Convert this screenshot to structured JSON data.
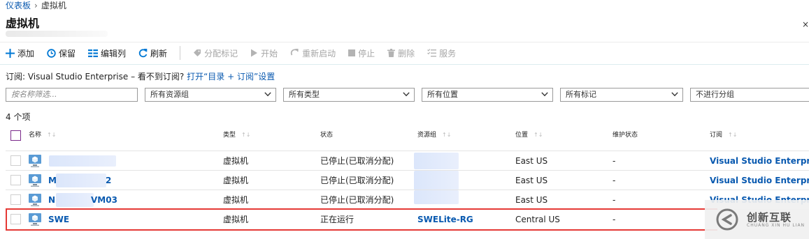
{
  "breadcrumb": {
    "home": "仪表板",
    "separator": "›",
    "current": "虚拟机"
  },
  "page": {
    "title": "虚拟机",
    "close_glyph": "×"
  },
  "toolbar": {
    "add": "添加",
    "save": "保留",
    "edit_columns": "编辑列",
    "refresh": "刷新",
    "assign_tags": "分配标记",
    "start": "开始",
    "restart": "重新启动",
    "stop": "停止",
    "delete": "删除",
    "services": "服务"
  },
  "subscription_line": {
    "prefix": "订阅: Visual Studio Enterprise – 看不到订阅? ",
    "link": "打开“目录 + 订阅”设置"
  },
  "filters": {
    "name_placeholder": "按名称筛选...",
    "resource_group": "所有资源组",
    "type": "所有类型",
    "location": "所有位置",
    "tags": "所有标记",
    "grouping": "不进行分组"
  },
  "count_label": "4 个项",
  "columns": {
    "name": "名称",
    "type": "类型",
    "status": "状态",
    "resource_group": "资源组",
    "location": "位置",
    "maintenance": "维护状态",
    "subscription": "订阅",
    "sort_glyph": "↑↓"
  },
  "rows": [
    {
      "name": "",
      "type": "虚拟机",
      "status": "已停止(已取消分配)",
      "resource_group": "",
      "location": "East US",
      "maintenance": "-",
      "subscription": "Visual Studio Enterpr..."
    },
    {
      "name": "M2",
      "type": "虚拟机",
      "status": "已停止(已取消分配)",
      "resource_group": "",
      "location": "East US",
      "maintenance": "-",
      "subscription": "Visual Studio Enterpr..."
    },
    {
      "name": "NVM03",
      "type": "虚拟机",
      "status": "已停止(已取消分配)",
      "resource_group": "",
      "location": "East US",
      "maintenance": "-",
      "subscription": "Visual Studio Enterpr..."
    },
    {
      "name": "SWE",
      "type": "虚拟机",
      "status": "正在运行",
      "resource_group": "SWELite-RG",
      "location": "Central US",
      "maintenance": "-",
      "subscription": ""
    }
  ],
  "row_name_parts": [
    {
      "prefix": "",
      "suffix": ""
    },
    {
      "prefix": "M",
      "suffix": "2"
    },
    {
      "prefix": "N",
      "suffix": "VM03"
    },
    {
      "prefix": "SWE",
      "suffix": ""
    }
  ],
  "watermark": {
    "text": "创新互联",
    "sub": "CHUANG XIN HU LIAN"
  },
  "colors": {
    "link": "#0a5ab0",
    "highlight": "#e53935",
    "accent": "#0078d4"
  }
}
